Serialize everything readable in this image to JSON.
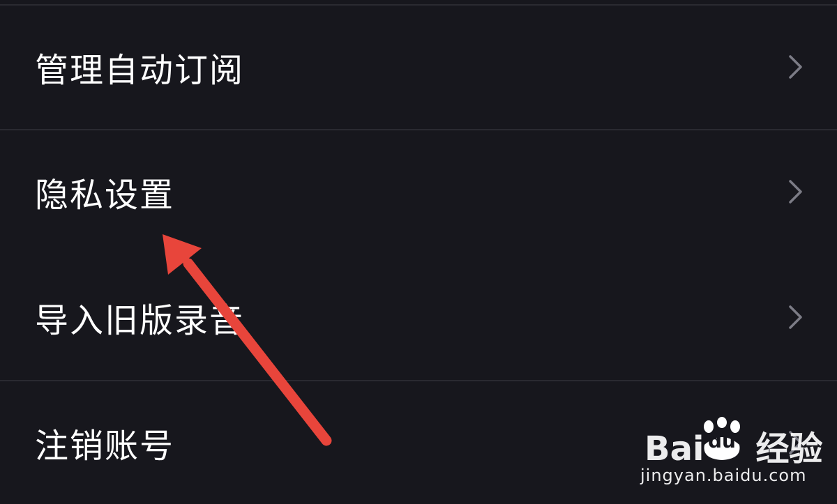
{
  "menu": {
    "items": [
      {
        "label": "管理自动订阅"
      },
      {
        "label": "隐私设置"
      },
      {
        "label": "导入旧版录音"
      },
      {
        "label": "注销账号"
      }
    ]
  },
  "watermark": {
    "brand": "Bai",
    "badge": "du",
    "suffix": "经验",
    "site": "jingyan.baidu.com"
  },
  "colors": {
    "background": "#17171d",
    "divider": "#2a2a31",
    "text": "#ffffff",
    "chevron": "#7c7c86",
    "annotation": "#e8453b"
  },
  "icons": {
    "chevron": "chevron-right-icon",
    "arrow": "red-annotation-arrow",
    "watermark": "baidu-paw-logo"
  }
}
